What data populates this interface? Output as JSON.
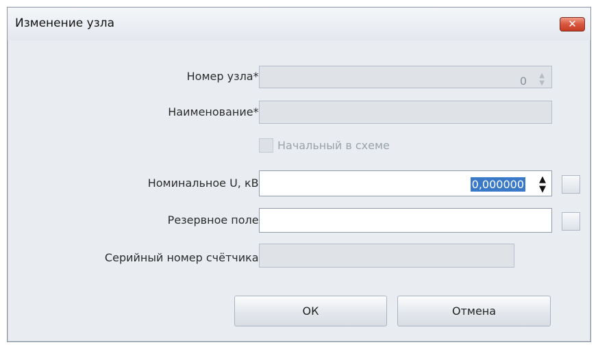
{
  "window": {
    "title": "Изменение узла"
  },
  "form": {
    "node_number": {
      "label": "Номер узла*:",
      "value": "0"
    },
    "name": {
      "label": "Наименование*:",
      "value": ""
    },
    "initial_in_scheme": {
      "label": "Начальный в схеме",
      "checked": false
    },
    "nominal_u": {
      "label": "Номинальное U, кВ:",
      "value": "0,000000"
    },
    "reserve_field": {
      "label": "Резервное поле:",
      "value": ""
    },
    "meter_serial": {
      "label": "Серийный номер счётчика:",
      "value": ""
    }
  },
  "buttons": {
    "ok": "ОК",
    "cancel": "Отмена"
  },
  "colors": {
    "close_button": "#d9573e",
    "selection": "#3a78c8",
    "window_bg": "#e9edf2"
  }
}
